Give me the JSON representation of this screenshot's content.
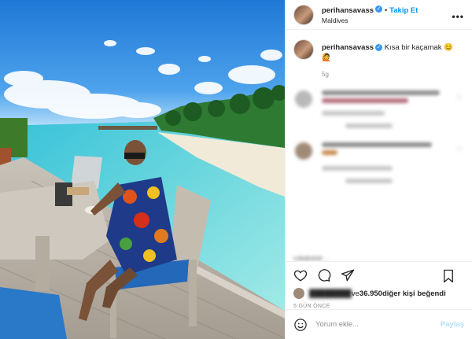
{
  "photo": {
    "description_icon": "maldives-photo"
  },
  "header": {
    "username": "perihansavass",
    "follow_label": "Takip Et",
    "location": "Maldives",
    "separator": "•",
    "more_label": "•••"
  },
  "caption": {
    "username": "perihansavass",
    "text": "Kısa bir kaçamak 😊",
    "emoji_line": "🙋",
    "time": "5g"
  },
  "comments": {
    "partial_visible": "cokabulutt ..."
  },
  "likes": {
    "prefix_blurred": "████████",
    "text_mid": " ve ",
    "count": "36.950",
    "suffix": " diğer kişi beğendi"
  },
  "posted_ago": "5 GÜN ÖNCE",
  "add_comment": {
    "placeholder": "Yorum ekle...",
    "post_label": "Paylaş"
  },
  "colors": {
    "accent": "#0095f6",
    "muted": "#8e8e8e",
    "border": "#efefef"
  }
}
